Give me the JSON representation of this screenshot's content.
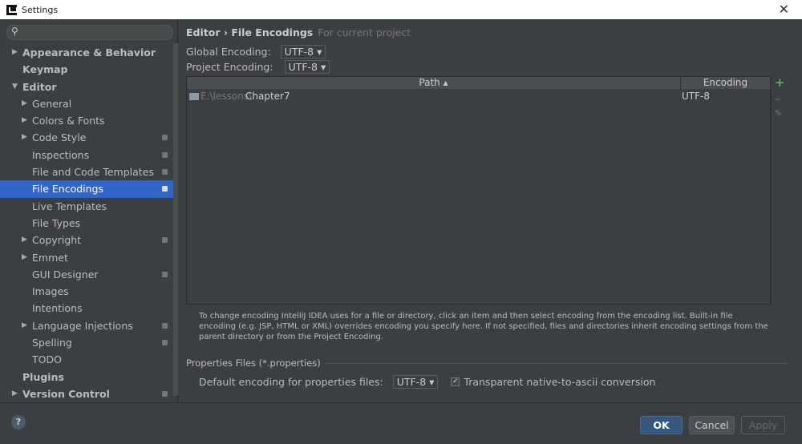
{
  "window": {
    "title": "Settings"
  },
  "sidebar": {
    "items": [
      {
        "label": "Appearance & Behavior",
        "level": 0,
        "bold": true,
        "arrow": "right"
      },
      {
        "label": "Keymap",
        "level": 0,
        "bold": true
      },
      {
        "label": "Editor",
        "level": 0,
        "bold": true,
        "arrow": "down"
      },
      {
        "label": "General",
        "level": 1,
        "arrow": "right"
      },
      {
        "label": "Colors & Fonts",
        "level": 1,
        "arrow": "right"
      },
      {
        "label": "Code Style",
        "level": 1,
        "arrow": "right",
        "project": true
      },
      {
        "label": "Inspections",
        "level": 1,
        "project": true
      },
      {
        "label": "File and Code Templates",
        "level": 1,
        "project": true
      },
      {
        "label": "File Encodings",
        "level": 1,
        "project": true,
        "selected": true
      },
      {
        "label": "Live Templates",
        "level": 1
      },
      {
        "label": "File Types",
        "level": 1
      },
      {
        "label": "Copyright",
        "level": 1,
        "arrow": "right",
        "project": true
      },
      {
        "label": "Emmet",
        "level": 1,
        "arrow": "right"
      },
      {
        "label": "GUI Designer",
        "level": 1,
        "project": true
      },
      {
        "label": "Images",
        "level": 1
      },
      {
        "label": "Intentions",
        "level": 1
      },
      {
        "label": "Language Injections",
        "level": 1,
        "arrow": "right",
        "project": true
      },
      {
        "label": "Spelling",
        "level": 1,
        "project": true
      },
      {
        "label": "TODO",
        "level": 1
      },
      {
        "label": "Plugins",
        "level": 0,
        "bold": true
      },
      {
        "label": "Version Control",
        "level": 0,
        "bold": true,
        "arrow": "right",
        "project": true
      }
    ]
  },
  "main": {
    "breadcrumb": "Editor › File Encodings",
    "scope": "For current project",
    "global_label": "Global Encoding:",
    "global_value": "UTF-8",
    "project_label": "Project Encoding:",
    "project_value": "UTF-8",
    "table": {
      "columns": [
        "Path ▴",
        "Encoding"
      ],
      "rows": [
        {
          "path_prefix": "E:\\lessons\\",
          "path_name": "Chapter7",
          "encoding": "UTF-8"
        }
      ]
    },
    "description": "To change encoding IntelliJ IDEA uses for a file or directory, click an item and then select encoding from the encoding list. Built-in file encoding (e.g. JSP, HTML or XML) overrides encoding you specify here. If not specified, files and directories inherit encoding settings from the parent directory or from the Project Encoding.",
    "properties_section": "Properties Files (*.properties)",
    "properties_label": "Default encoding for properties files:",
    "properties_value": "UTF-8",
    "native_ascii_label": "Transparent native-to-ascii conversion",
    "native_ascii_checked": true
  },
  "buttons": {
    "ok": "OK",
    "cancel": "Cancel",
    "apply": "Apply",
    "help": "?"
  },
  "colors": {
    "selection": "#2f65ca",
    "ok": "#365880",
    "add": "#59a869"
  }
}
